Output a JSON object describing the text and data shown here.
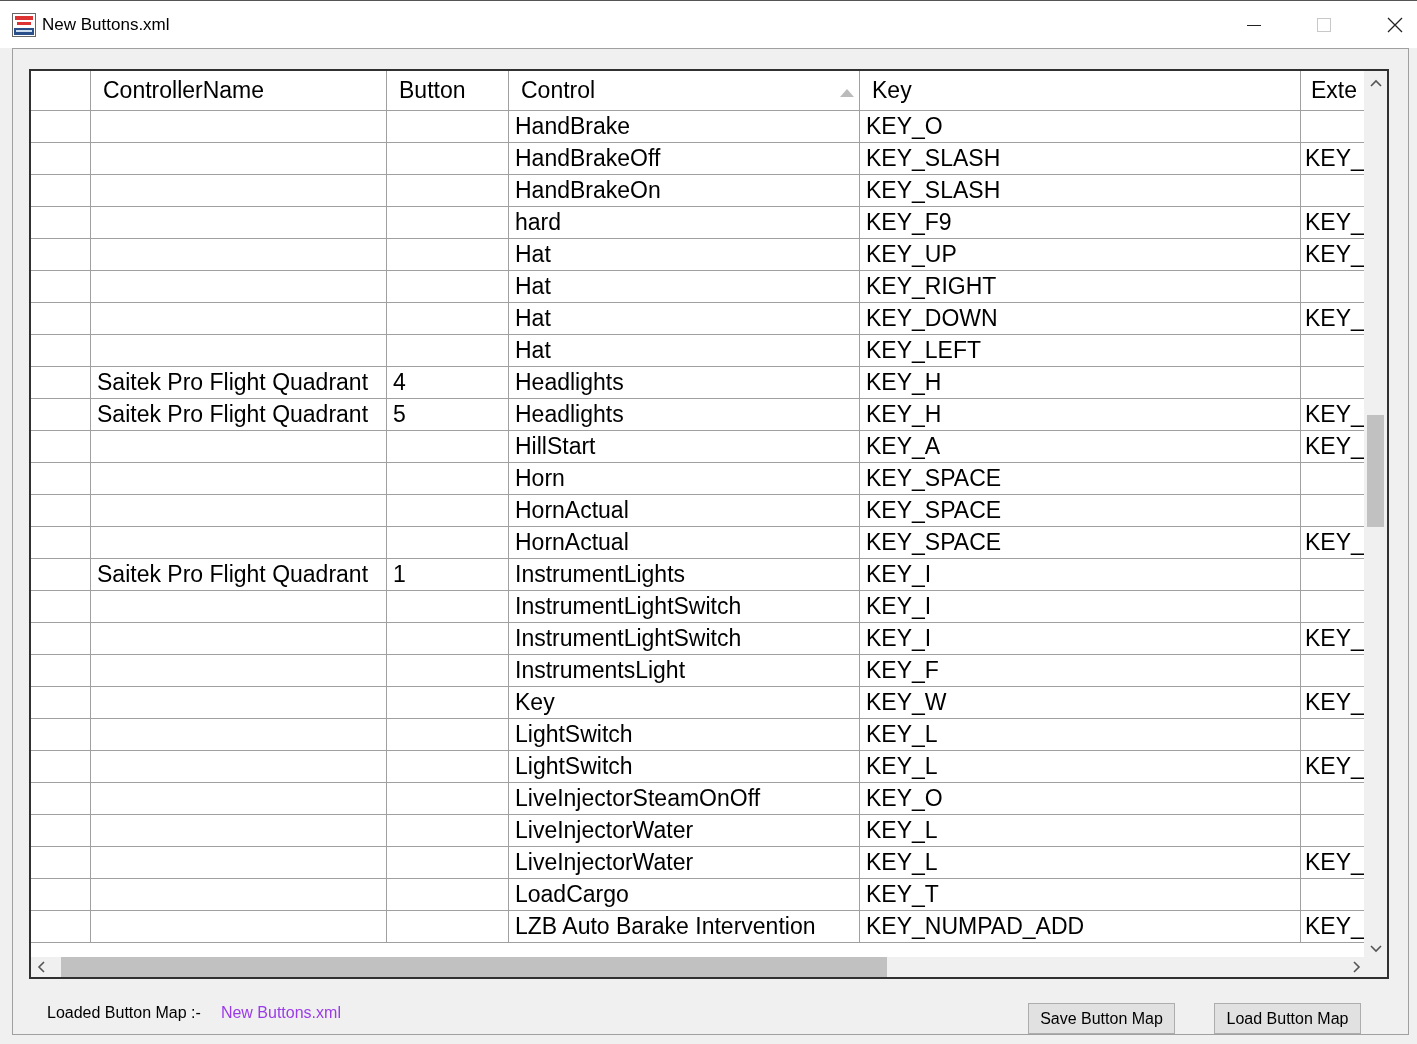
{
  "window": {
    "title": "New Buttons.xml",
    "maximize_disabled": true
  },
  "table": {
    "columns": [
      {
        "label": "ControllerName"
      },
      {
        "label": "Button"
      },
      {
        "label": "Control",
        "sorted": true
      },
      {
        "label": "Key"
      },
      {
        "label": "Exte"
      }
    ],
    "rows": [
      {
        "control": "HandBrake",
        "key": "KEY_O"
      },
      {
        "control": "HandBrakeOff",
        "key": "KEY_SLASH",
        "column_5": "KEY_"
      },
      {
        "control": "HandBrakeOn",
        "key": "KEY_SLASH"
      },
      {
        "control": "hard",
        "key": "KEY_F9",
        "column_5": "KEY_"
      },
      {
        "control": "Hat",
        "key": "KEY_UP",
        "column_5": "KEY_"
      },
      {
        "control": "Hat",
        "key": "KEY_RIGHT"
      },
      {
        "control": "Hat",
        "key": "KEY_DOWN",
        "column_5": "KEY_"
      },
      {
        "control": "Hat",
        "key": "KEY_LEFT"
      },
      {
        "controller_name": "Saitek Pro Flight Quadrant",
        "button": "4",
        "control": "Headlights",
        "key": "KEY_H"
      },
      {
        "controller_name": "Saitek Pro Flight Quadrant",
        "button": "5",
        "control": "Headlights",
        "key": "KEY_H",
        "column_5": "KEY_"
      },
      {
        "control": "HillStart",
        "key": "KEY_A",
        "column_5": "KEY_"
      },
      {
        "control": "Horn",
        "key": "KEY_SPACE"
      },
      {
        "control": "HornActual",
        "key": "KEY_SPACE"
      },
      {
        "control": "HornActual",
        "key": "KEY_SPACE",
        "column_5": "KEY_"
      },
      {
        "controller_name": "Saitek Pro Flight Quadrant",
        "button": "1",
        "control": "InstrumentLights",
        "key": "KEY_I"
      },
      {
        "control": "InstrumentLightSwitch",
        "key": "KEY_I"
      },
      {
        "control": "InstrumentLightSwitch",
        "key": "KEY_I",
        "column_5": "KEY_"
      },
      {
        "control": "InstrumentsLight",
        "key": "KEY_F"
      },
      {
        "control": "Key",
        "key": "KEY_W",
        "column_5": "KEY_"
      },
      {
        "control": "LightSwitch",
        "key": "KEY_L"
      },
      {
        "control": "LightSwitch",
        "key": "KEY_L",
        "column_5": "KEY_"
      },
      {
        "control": "LiveInjectorSteamOnOff",
        "key": "KEY_O"
      },
      {
        "control": "LiveInjectorWater",
        "key": "KEY_L"
      },
      {
        "control": "LiveInjectorWater",
        "key": "KEY_L",
        "column_5": "KEY_"
      },
      {
        "control": "LoadCargo",
        "key": "KEY_T"
      },
      {
        "control": "LZB Auto Barake Intervention",
        "key": "KEY_NUMPAD_ADD",
        "column_5": "KEY_"
      }
    ]
  },
  "status": {
    "label": "Loaded Button Map :-",
    "file": "New Buttons.xml"
  },
  "buttons": [
    "Save Button Map",
    "Load Button Map"
  ]
}
